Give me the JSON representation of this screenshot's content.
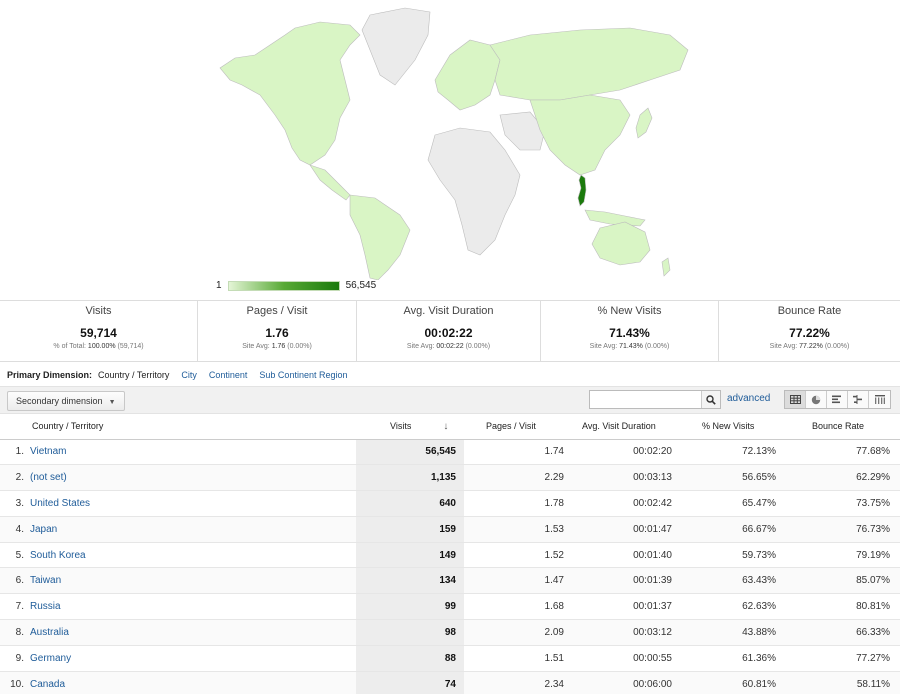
{
  "legend": {
    "min": "1",
    "max": "56,545"
  },
  "colors": {
    "map_fill": "#d9f5c5",
    "map_grey": "#ebebeb",
    "map_dark": "#1b7a0c",
    "link": "#1f5c99"
  },
  "scorecards": [
    {
      "label": "Visits",
      "value": "59,714",
      "sub_prefix": "% of Total:",
      "sub_value": "100.00%",
      "sub_suffix": "(59,714)"
    },
    {
      "label": "Pages / Visit",
      "value": "1.76",
      "sub_prefix": "Site Avg:",
      "sub_value": "1.76",
      "sub_suffix": "(0.00%)"
    },
    {
      "label": "Avg. Visit Duration",
      "value": "00:02:22",
      "sub_prefix": "Site Avg:",
      "sub_value": "00:02:22",
      "sub_suffix": "(0.00%)"
    },
    {
      "label": "% New Visits",
      "value": "71.43%",
      "sub_prefix": "Site Avg:",
      "sub_value": "71.43%",
      "sub_suffix": "(0.00%)"
    },
    {
      "label": "Bounce Rate",
      "value": "77.22%",
      "sub_prefix": "Site Avg:",
      "sub_value": "77.22%",
      "sub_suffix": "(0.00%)"
    }
  ],
  "primary_dimension": {
    "label": "Primary Dimension:",
    "current": "Country / Territory",
    "links": [
      "City",
      "Continent",
      "Sub Continent Region"
    ]
  },
  "controls": {
    "secondary_dimension": "Secondary dimension",
    "search_placeholder": "",
    "advanced": "advanced",
    "view_icons": [
      "grid-view-icon",
      "pie-view-icon",
      "performance-view-icon",
      "comparison-view-icon",
      "pivot-view-icon"
    ]
  },
  "table": {
    "headers": {
      "name": "Country / Territory",
      "visits": "Visits",
      "pages": "Pages / Visit",
      "duration": "Avg. Visit Duration",
      "new_visits": "% New Visits",
      "bounce": "Bounce Rate"
    },
    "rows": [
      {
        "idx": "1.",
        "name": "Vietnam",
        "visits": "56,545",
        "pages": "1.74",
        "duration": "00:02:20",
        "new_visits": "72.13%",
        "bounce": "77.68%"
      },
      {
        "idx": "2.",
        "name": "(not set)",
        "visits": "1,135",
        "pages": "2.29",
        "duration": "00:03:13",
        "new_visits": "56.65%",
        "bounce": "62.29%"
      },
      {
        "idx": "3.",
        "name": "United States",
        "visits": "640",
        "pages": "1.78",
        "duration": "00:02:42",
        "new_visits": "65.47%",
        "bounce": "73.75%"
      },
      {
        "idx": "4.",
        "name": "Japan",
        "visits": "159",
        "pages": "1.53",
        "duration": "00:01:47",
        "new_visits": "66.67%",
        "bounce": "76.73%"
      },
      {
        "idx": "5.",
        "name": "South Korea",
        "visits": "149",
        "pages": "1.52",
        "duration": "00:01:40",
        "new_visits": "59.73%",
        "bounce": "79.19%"
      },
      {
        "idx": "6.",
        "name": "Taiwan",
        "visits": "134",
        "pages": "1.47",
        "duration": "00:01:39",
        "new_visits": "63.43%",
        "bounce": "85.07%"
      },
      {
        "idx": "7.",
        "name": "Russia",
        "visits": "99",
        "pages": "1.68",
        "duration": "00:01:37",
        "new_visits": "62.63%",
        "bounce": "80.81%"
      },
      {
        "idx": "8.",
        "name": "Australia",
        "visits": "98",
        "pages": "2.09",
        "duration": "00:03:12",
        "new_visits": "43.88%",
        "bounce": "66.33%"
      },
      {
        "idx": "9.",
        "name": "Germany",
        "visits": "88",
        "pages": "1.51",
        "duration": "00:00:55",
        "new_visits": "61.36%",
        "bounce": "77.27%"
      },
      {
        "idx": "10.",
        "name": "Canada",
        "visits": "74",
        "pages": "2.34",
        "duration": "00:06:00",
        "new_visits": "60.81%",
        "bounce": "58.11%"
      }
    ]
  }
}
